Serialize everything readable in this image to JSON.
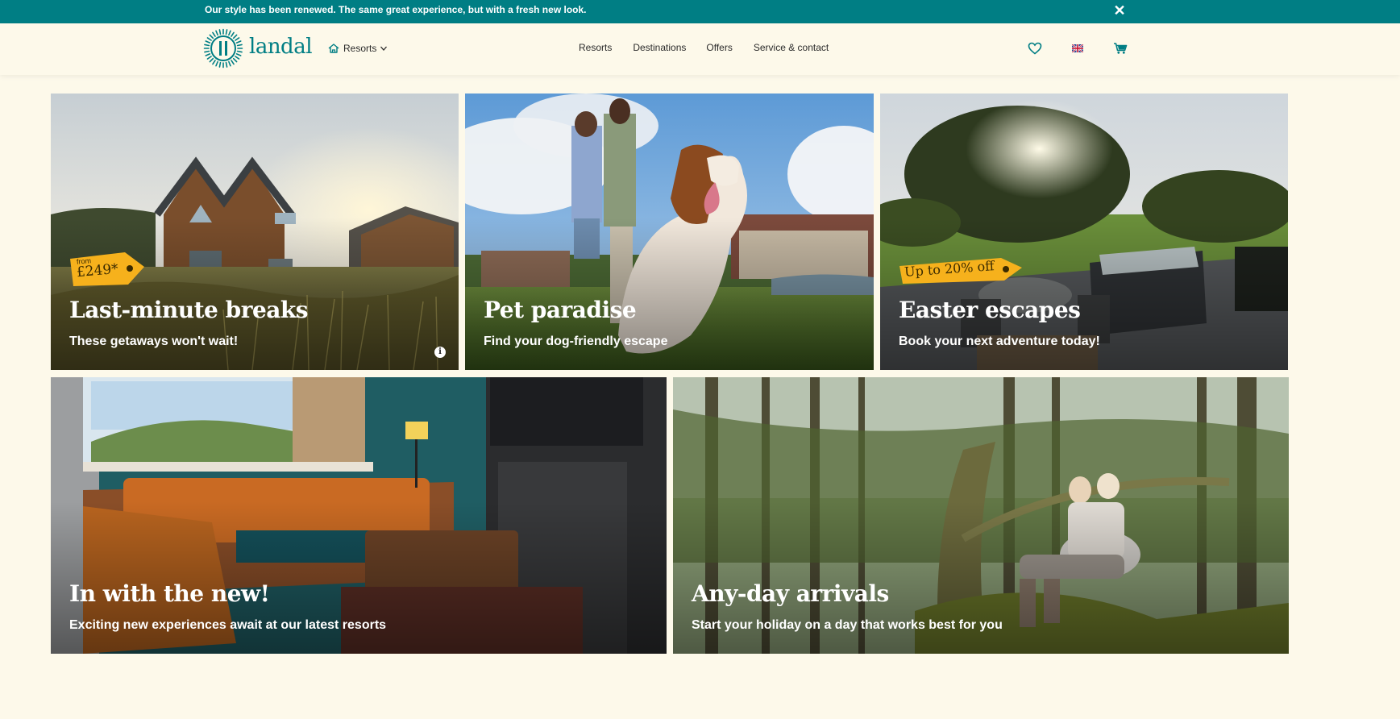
{
  "banner": {
    "message": "Our style has been renewed. The same great experience, but with a fresh new look.",
    "close": "✕"
  },
  "header": {
    "logo_text": "landal",
    "resorts_dropdown": "Resorts",
    "nav": [
      "Resorts",
      "Destinations",
      "Offers",
      "Service & contact"
    ]
  },
  "colors": {
    "brand_teal": "#007e84",
    "page_bg": "#fdf9ea",
    "tag_yellow": "#f6b11c"
  },
  "cards": [
    {
      "title": "Last-minute breaks",
      "subtitle": "These getaways won't wait!",
      "tag_from": "from",
      "tag_price": "£249*",
      "info": "i"
    },
    {
      "title": "Pet paradise",
      "subtitle": "Find your dog-friendly escape"
    },
    {
      "title": "Easter escapes",
      "subtitle": "Book your next adventure today!",
      "tag_text": "Up to 20% off"
    },
    {
      "title": "In with the new!",
      "subtitle": "Exciting new experiences await at our latest resorts"
    },
    {
      "title": "Any-day arrivals",
      "subtitle": "Start your holiday on a day that works best for you"
    }
  ]
}
